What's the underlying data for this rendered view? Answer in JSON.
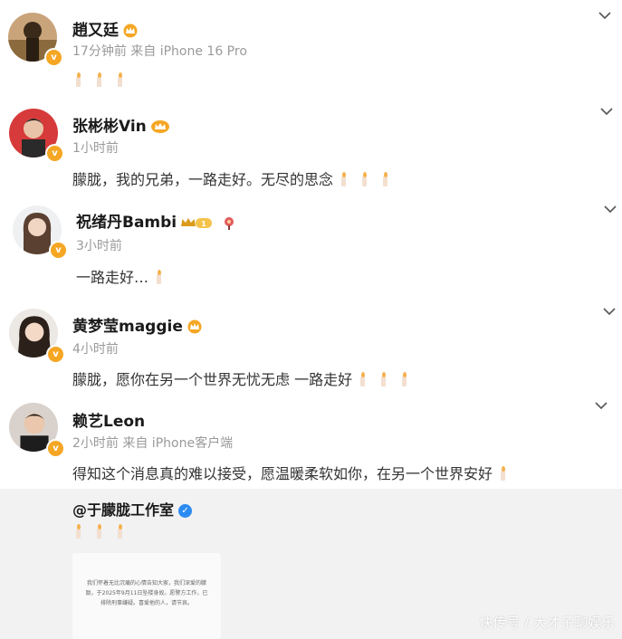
{
  "comments": [
    {
      "username": "趙又廷",
      "meta": "17分钟前 来自 iPhone 16 Pro",
      "content": ""
    },
    {
      "username": "张彬彬Vin",
      "meta": "1小时前",
      "content": "朦胧，我的兄弟，一路走好。无尽的思念"
    },
    {
      "username": "祝绪丹Bambi",
      "meta": "3小时前",
      "content": "一路走好…"
    },
    {
      "username": "黄梦莹maggie",
      "meta": "4小时前",
      "content": "朦胧，愿你在另一个世界无忧无虑 一路走好"
    },
    {
      "username": "赖艺Leon",
      "meta": "2小时前 来自 iPhone客户端",
      "content": "得知这个消息真的难以接受，愿温暖柔软如你，在另一个世界安好"
    }
  ],
  "studio": {
    "name": "@于朦胧工作室"
  },
  "notice": {
    "text": "我们怀着无比沉痛的心情告知大家，我们深爱的朦胧，于2025年9月11日坠楼身故。愿警方工作，已排除刑事嫌疑。喜爱他的人，请节哀。"
  },
  "watermark": "快传号 / 大才子聊娱乐",
  "colors": {
    "gold_badge": "#f5a623",
    "blue_verify": "#2b8bf2",
    "meta_gray": "#9a9a9a"
  }
}
